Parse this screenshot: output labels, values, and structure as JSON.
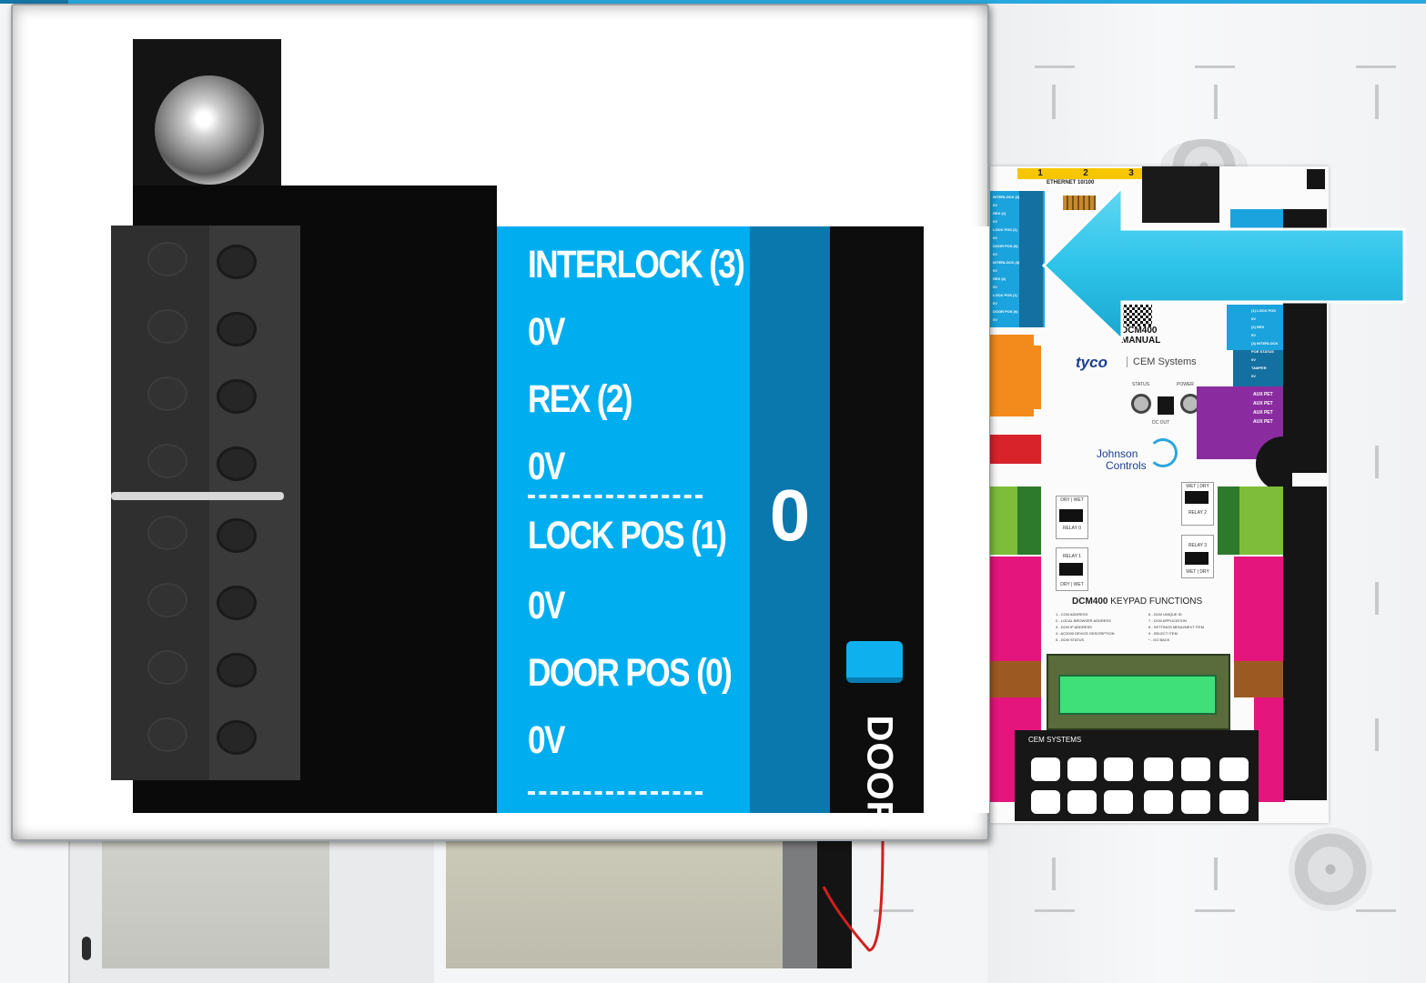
{
  "magnified": {
    "terminal_labels": [
      "INTERLOCK (3)",
      "0V",
      "REX (2)",
      "0V",
      "LOCK POS (1)",
      "0V",
      "DOOR POS (0)",
      "0V"
    ],
    "door_number": "0",
    "door_label": "DOOR"
  },
  "board": {
    "ethernet_ports": [
      "1",
      "2",
      "3"
    ],
    "ethernet_label": "ETHERNET 10/100",
    "manual_label": [
      "DCM400",
      "MANUAL"
    ],
    "brand_tyco": "tyco",
    "brand_cem": "CEM Systems",
    "brand_jc": [
      "Johnson",
      "Controls"
    ],
    "status_label": "STATUS",
    "power_label": "POWER",
    "dc_out_label": "DC OUT",
    "relays": [
      {
        "title": "DRY | WET",
        "name": "RELAY 0"
      },
      {
        "title": "RELAY 1",
        "name": "DRY | WET"
      },
      {
        "title": "WET | DRY",
        "name": "RELAY 2"
      },
      {
        "title": "RELAY 3",
        "name": "WET | DRY"
      }
    ],
    "keypad_title_bold": "DCM400",
    "keypad_title_rest": " KEYPAD FUNCTIONS",
    "keypad_functions_left": "1 - CCM ADDRESS\n2 - LOCAL BROWSER ADDRESS\n3 - DCM IP ADDRESS\n4 - AC2000 DEVICE DESCRIPTION\n5 - DCM STATUS",
    "keypad_functions_right": "6 - DCM UNIQUE ID\n7 - DCM APPLICATION\n8 - SETTINGS MENU/NEXT ITEM\n9 - SELECT ITEM\n* - GO BACK",
    "keypad_brand": "CEM SYSTEMS",
    "door_inputs_left": "INTERLOCK (3)\n0V\nREX (2)\n0V\nLOCK POS (1)\n0V\nDOOR POS (0)\n0V\nINTERLOCK (3)\n0V\nREX (2)\n0V\nLOCK POS (1)\n0V\nDOOR POS (0)\n0V",
    "door_inputs_right": "(1) LOCK POS\n0V\n(2) REX\n0V\n(3) INTERLOCK\nPOE STATUS\n0V\nTAMPER\n0V",
    "aux_labels": "AUX PET\n\nAUX PET\n\nAUX PET\n\nAUX PET"
  },
  "colors": {
    "accent_blue": "#00aeef",
    "dark_blue": "#0a78ad",
    "arrow": "#2ec4ea"
  }
}
